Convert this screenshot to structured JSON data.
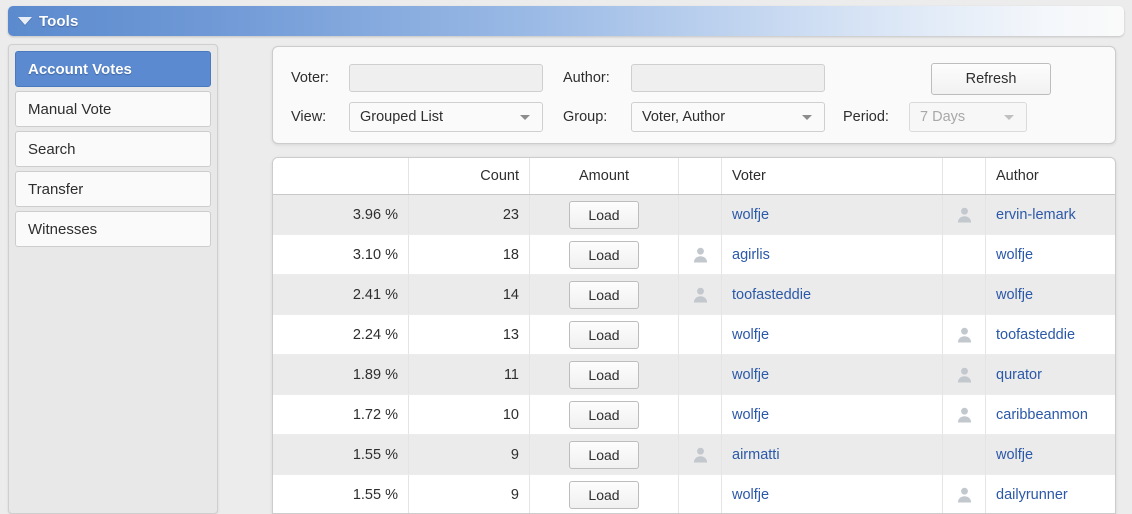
{
  "titlebar": {
    "twisty_icon": "triangle-down-icon",
    "title": "Tools"
  },
  "sidebar": {
    "items": [
      {
        "label": "Account Votes",
        "selected": true
      },
      {
        "label": "Manual Vote",
        "selected": false
      },
      {
        "label": "Search",
        "selected": false
      },
      {
        "label": "Transfer",
        "selected": false
      },
      {
        "label": "Witnesses",
        "selected": false
      }
    ]
  },
  "filters": {
    "voter_label": "Voter:",
    "voter_value": "",
    "voter_placeholder": "",
    "author_label": "Author:",
    "author_value": "",
    "author_placeholder": "",
    "view_label": "View:",
    "view_value": "Grouped List",
    "group_label": "Group:",
    "group_value": "Voter, Author",
    "period_label": "Period:",
    "period_value": "7 Days",
    "period_disabled": true,
    "refresh_label": "Refresh"
  },
  "table": {
    "headers": {
      "percent": "",
      "count": "Count",
      "amount": "Amount",
      "voter_avatar": "",
      "voter": "Voter",
      "author_avatar": "",
      "author": "Author"
    },
    "load_label": "Load",
    "rows": [
      {
        "percent": "3.96 %",
        "count": "23",
        "amount": "Load",
        "voter_avatar": false,
        "voter": "wolfje",
        "author_avatar": true,
        "author": "ervin-lemark"
      },
      {
        "percent": "3.10 %",
        "count": "18",
        "amount": "Load",
        "voter_avatar": true,
        "voter": "agirlis",
        "author_avatar": false,
        "author": "wolfje"
      },
      {
        "percent": "2.41 %",
        "count": "14",
        "amount": "Load",
        "voter_avatar": true,
        "voter": "toofasteddie",
        "author_avatar": false,
        "author": "wolfje"
      },
      {
        "percent": "2.24 %",
        "count": "13",
        "amount": "Load",
        "voter_avatar": false,
        "voter": "wolfje",
        "author_avatar": true,
        "author": "toofasteddie"
      },
      {
        "percent": "1.89 %",
        "count": "11",
        "amount": "Load",
        "voter_avatar": false,
        "voter": "wolfje",
        "author_avatar": true,
        "author": "qurator"
      },
      {
        "percent": "1.72 %",
        "count": "10",
        "amount": "Load",
        "voter_avatar": false,
        "voter": "wolfje",
        "author_avatar": true,
        "author": "caribbeanmon"
      },
      {
        "percent": "1.55 %",
        "count": "9",
        "amount": "Load",
        "voter_avatar": true,
        "voter": "airmatti",
        "author_avatar": false,
        "author": "wolfje"
      },
      {
        "percent": "1.55 %",
        "count": "9",
        "amount": "Load",
        "voter_avatar": false,
        "voter": "wolfje",
        "author_avatar": true,
        "author": "dailyrunner"
      }
    ]
  },
  "colors": {
    "accent_blue": "#5b8ad0",
    "link_blue": "#2b58a8",
    "row_alt": "#ebebeb",
    "page_bg": "#ececec"
  }
}
